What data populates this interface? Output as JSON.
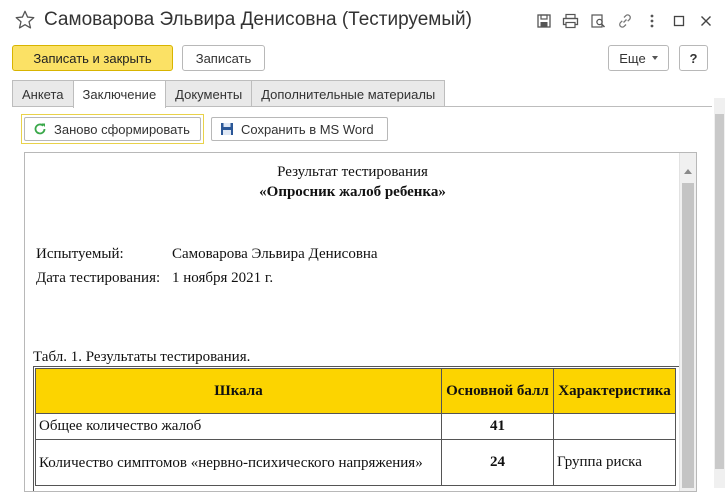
{
  "window": {
    "title": "Самоварова Эльвира Денисовна (Тестируемый)",
    "icons": [
      "star-icon",
      "save-icon",
      "print-icon",
      "search-doc-icon",
      "link-icon",
      "more-icon",
      "maximize-icon",
      "close-icon"
    ]
  },
  "toolbar": {
    "save_close_label": "Записать и закрыть",
    "save_label": "Записать",
    "more_label": "Еще",
    "help_label": "?"
  },
  "tabs": [
    {
      "label": "Анкета"
    },
    {
      "label": "Заключение"
    },
    {
      "label": "Документы"
    },
    {
      "label": "Дополнительные материалы"
    }
  ],
  "panel": {
    "regenerate_label": "Заново сформировать",
    "save_word_label": "Сохранить в MS Word"
  },
  "report": {
    "title": "Результат тестирования",
    "subtitle": "«Опросник жалоб ребенка»",
    "subject_label": "Испытуемый:",
    "subject_value": "Самоварова Эльвира Денисовна",
    "date_label": "Дата тестирования:",
    "date_value": "1 ноября 2021 г.",
    "table_caption": "Табл. 1. Результаты тестирования.",
    "columns": [
      "Шкала",
      "Основной балл",
      "Характеристика"
    ],
    "rows": [
      {
        "scale": "Общее количество жалоб",
        "score": "41",
        "characteristic": ""
      },
      {
        "scale": "Количество симптомов «нервно-психического напряжения»",
        "score": "24",
        "characteristic": "Группа риска"
      }
    ]
  },
  "colors": {
    "accent_yellow": "#fbe165",
    "table_header": "#fcd400",
    "regen_icon": "#3aa84a",
    "word_icon": "#2b5797"
  }
}
